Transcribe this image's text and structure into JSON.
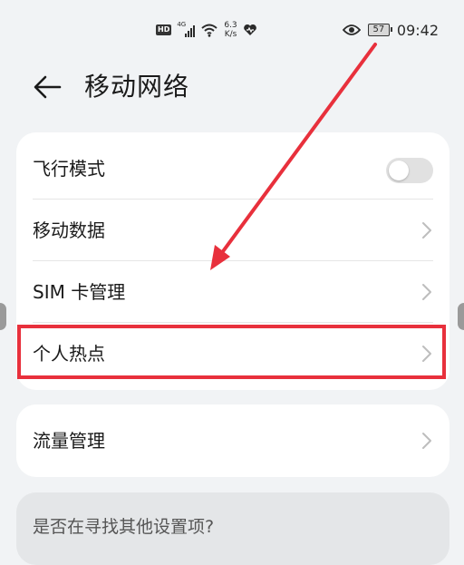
{
  "status_bar": {
    "hd_badge": "HD",
    "network_type": "4G",
    "speed_value": "6.3",
    "speed_unit": "K/s",
    "battery": "57",
    "time": "09:42"
  },
  "header": {
    "title": "移动网络"
  },
  "settings_card": {
    "items": [
      {
        "label": "飞行模式",
        "toggle_on": false
      },
      {
        "label": "移动数据"
      },
      {
        "label": "SIM 卡管理"
      },
      {
        "label": "个人热点"
      }
    ]
  },
  "data_card": {
    "items": [
      {
        "label": "流量管理"
      }
    ]
  },
  "search_hint": {
    "text": "是否在寻找其他设置项?"
  },
  "colors": {
    "annotation": "#e8303c",
    "background": "#f1f3f5",
    "card": "#ffffff"
  },
  "icons": [
    "hd-icon",
    "signal-icon",
    "wifi-icon",
    "heart-icon",
    "eye-icon",
    "battery-icon",
    "back-arrow-icon",
    "chevron-right-icon"
  ]
}
